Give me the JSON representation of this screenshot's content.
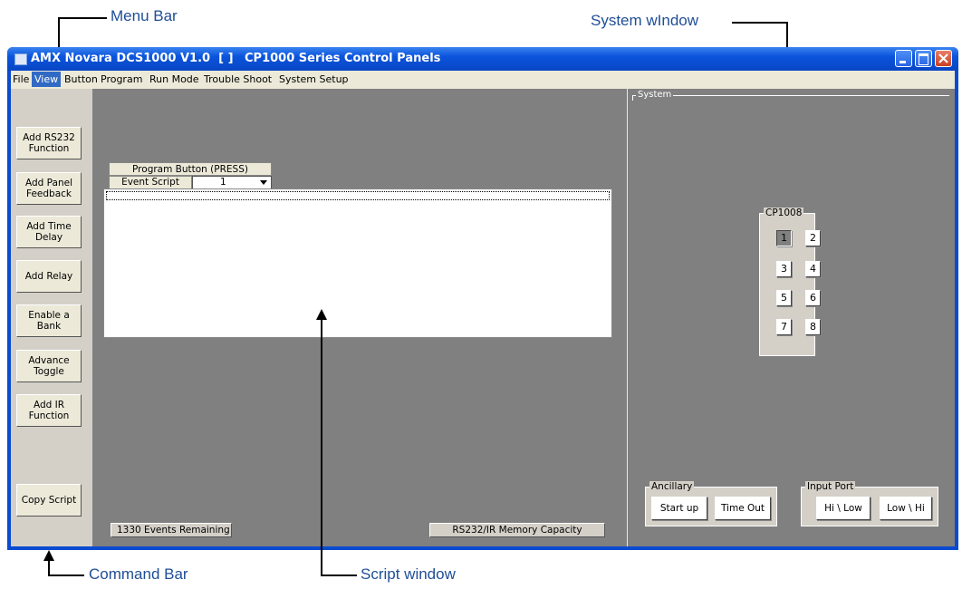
{
  "callouts": {
    "menu_bar": "Menu Bar",
    "system_window": "System wIndow",
    "command_bar": "Command Bar",
    "script_window": "Script window"
  },
  "window": {
    "title_left": "AMX Novara DCS1000 V1.0  [ ]",
    "title_right": "CP1000 Series Control Panels"
  },
  "menu": [
    "File",
    "View",
    "Button",
    "Program",
    "Run Mode",
    "Trouble Shoot",
    "System Setup"
  ],
  "menu_active": "View",
  "command_bar": {
    "buttons": [
      "Add RS232\nFunction",
      "Add Panel\nFeedback",
      "Add Time\nDelay",
      "Add Relay",
      "Enable a\nBank",
      "Advance\nToggle",
      "Add IR\nFunction",
      "Copy Script"
    ]
  },
  "script": {
    "program_label": "Program Button (PRESS)",
    "event_label": "Event Script",
    "event_value": "1"
  },
  "status": {
    "events_remaining": "1330 Events Remaining",
    "memory_capacity": "RS232/IR Memory Capacity"
  },
  "system": {
    "label": "System",
    "panel_label": "CP1008",
    "panel_buttons": [
      "1",
      "2",
      "3",
      "4",
      "5",
      "6",
      "7",
      "8"
    ],
    "pressed_button": "1",
    "ancillary": {
      "label": "Ancillary",
      "buttons": [
        "Start up",
        "Time Out"
      ]
    },
    "input_port": {
      "label": "Input Port",
      "buttons": [
        "Hi \\ Low",
        "Low \\ Hi"
      ]
    }
  },
  "colors": {
    "title_bar": "#0b54dc",
    "menu_active": "#316ac5",
    "client_bg": "#808080",
    "panel_bg": "#d4d0c8",
    "callout_text": "#1f4e96"
  }
}
